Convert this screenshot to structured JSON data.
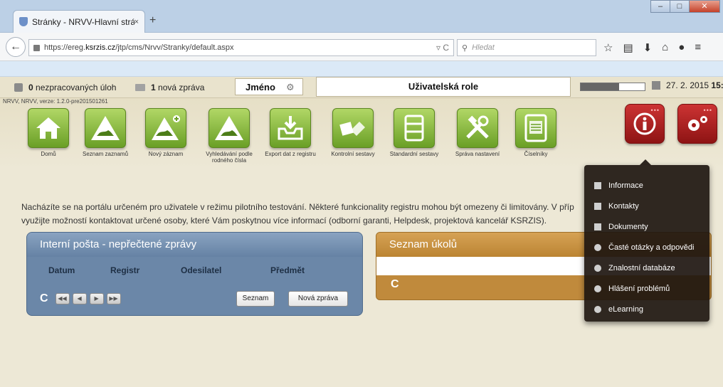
{
  "browser": {
    "tab_title": "Stránky - NRVV-Hlavní strá...",
    "tab_close": "×",
    "new_tab": "+",
    "url_prefix": "https://ereg.",
    "url_domain": "ksrzis.cz",
    "url_suffix": "/jtp/cms/Nrvv/Stranky/default.aspx",
    "search_placeholder": "Hledat"
  },
  "header": {
    "tasks_count": "0",
    "tasks_label": "nezpracovaných úloh",
    "messages_count": "1",
    "messages_label": "nová zpráva",
    "name_label": "Jméno",
    "role_label": "Uživatelská role",
    "date": "27. 2. 2015",
    "time": "15:1",
    "progress": 0.6
  },
  "version": "NRVV, NRVV, verze: 1.2.0-pre201501261",
  "modules": [
    {
      "label": "Domů"
    },
    {
      "label": "Seznam zaznamů"
    },
    {
      "label": "Nový záznam"
    },
    {
      "label": "Vyhledávání podle rodného čísla"
    },
    {
      "label": "Export dat z registru"
    },
    {
      "label": "Kontrolní sestavy"
    },
    {
      "label": "Standardní sestavy"
    },
    {
      "label": "Správa nastavení"
    },
    {
      "label": "Číselníky"
    }
  ],
  "notice": {
    "line1": "Nacházíte se na portálu určeném pro uživatele v režimu pilotního testování. Některé funkcionality registru mohou být omezeny či limitovány. V příp",
    "line2": "využijte možností kontaktovat určené osoby, které Vám poskytnou více informací (odborní garanti,  Helpdesk, projektová kancelář KSRZIS)."
  },
  "mail_panel": {
    "title": "Interní pošta - nepřečtené zprávy",
    "columns": [
      "Datum",
      "Registr",
      "Odesilatel",
      "Předmět"
    ],
    "list_button": "Seznam",
    "new_button": "Nová zpráva"
  },
  "tasks_panel": {
    "title": "Seznam úkolů"
  },
  "info_menu": {
    "items": [
      {
        "label": "Informace",
        "icon": "document-icon"
      },
      {
        "label": "Kontakty",
        "icon": "document-icon"
      },
      {
        "label": "Dokumenty",
        "icon": "document-icon"
      },
      {
        "label": "Časté otázky a odpovědi",
        "icon": "question-icon"
      },
      {
        "label": "Znalostní databáze",
        "icon": "lifebuoy-icon"
      },
      {
        "label": "Hlášení problémů",
        "icon": "speech-bubble-icon"
      },
      {
        "label": "eLearning",
        "icon": "lifebuoy-icon"
      }
    ]
  }
}
